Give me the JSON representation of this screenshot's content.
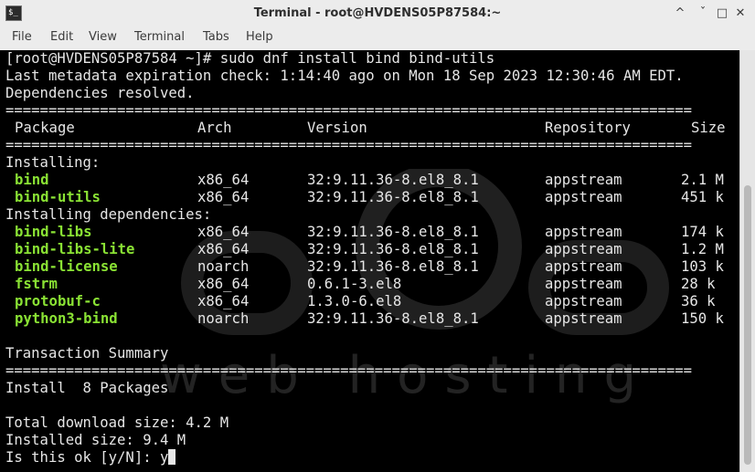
{
  "window": {
    "title": "Terminal - root@HVDENS05P87584:~",
    "controls": [
      "^",
      "ˇ",
      "□",
      "✕"
    ]
  },
  "menubar": [
    "File",
    "Edit",
    "View",
    "Terminal",
    "Tabs",
    "Help"
  ],
  "terminal": {
    "command_line": "[root@HVDENS05P87584 ~]# sudo dnf install bind bind-utils",
    "metadata_line": "Last metadata expiration check: 1:14:40 ago on Mon 18 Sep 2023 12:30:46 AM EDT.",
    "deps_line": "Dependencies resolved.",
    "separator": "================================================================================",
    "headers": {
      "package": "Package",
      "arch": "Arch",
      "version": "Version",
      "repo": "Repository",
      "size": "Size"
    },
    "installing_label": "Installing:",
    "installing": [
      {
        "package": "bind",
        "arch": "x86_64",
        "version": "32:9.11.36-8.el8_8.1",
        "repo": "appstream",
        "size": "2.1 M"
      },
      {
        "package": "bind-utils",
        "arch": "x86_64",
        "version": "32:9.11.36-8.el8_8.1",
        "repo": "appstream",
        "size": "451 k"
      }
    ],
    "deps_label": "Installing dependencies:",
    "dependencies": [
      {
        "package": "bind-libs",
        "arch": "x86_64",
        "version": "32:9.11.36-8.el8_8.1",
        "repo": "appstream",
        "size": "174 k"
      },
      {
        "package": "bind-libs-lite",
        "arch": "x86_64",
        "version": "32:9.11.36-8.el8_8.1",
        "repo": "appstream",
        "size": "1.2 M"
      },
      {
        "package": "bind-license",
        "arch": "noarch",
        "version": "32:9.11.36-8.el8_8.1",
        "repo": "appstream",
        "size": "103 k"
      },
      {
        "package": "fstrm",
        "arch": "x86_64",
        "version": "0.6.1-3.el8",
        "repo": "appstream",
        "size": "28 k"
      },
      {
        "package": "protobuf-c",
        "arch": "x86_64",
        "version": "1.3.0-6.el8",
        "repo": "appstream",
        "size": "36 k"
      },
      {
        "package": "python3-bind",
        "arch": "noarch",
        "version": "32:9.11.36-8.el8_8.1",
        "repo": "appstream",
        "size": "150 k"
      }
    ],
    "summary_label": "Transaction Summary",
    "install_count": "Install  8 Packages",
    "download_size": "Total download size: 4.2 M",
    "installed_size": "Installed size: 9.4 M",
    "prompt": "Is this ok [y/N]: y"
  },
  "watermark": {
    "line1": "ace",
    "line2": "web hosting"
  },
  "colors": {
    "package_name": "#8ae234",
    "terminal_bg": "#000000",
    "terminal_fg": "#e6e6e6"
  }
}
